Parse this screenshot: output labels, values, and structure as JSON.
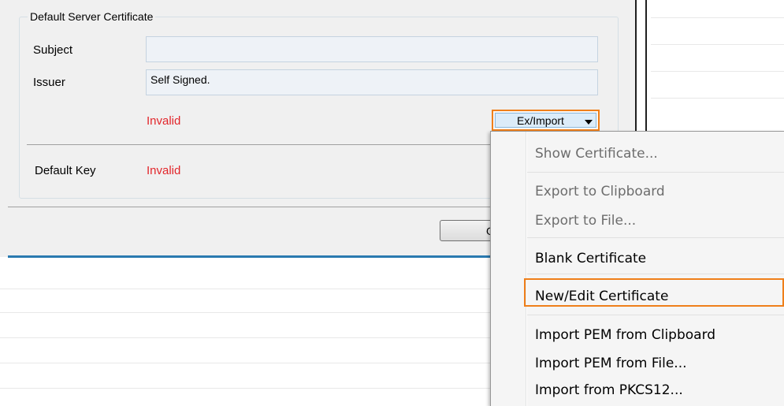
{
  "group": {
    "title": "Default Server Certificate"
  },
  "subject": {
    "label": "Subject",
    "value": ""
  },
  "issuer": {
    "label": "Issuer",
    "value": "Self Signed."
  },
  "cert_status": "Invalid",
  "default_key": {
    "label": "Default Key",
    "status": "Invalid"
  },
  "ex_import_button": {
    "label": "Ex/Import"
  },
  "ok_button": {
    "label": "OK"
  },
  "menu": {
    "show_certificate": "Show Certificate...",
    "export_clipboard": "Export to Clipboard",
    "export_file": "Export to File...",
    "blank_certificate": "Blank Certificate",
    "new_edit_certificate": "New/Edit Certificate",
    "import_pem_clipboard": "Import PEM from Clipboard",
    "import_pem_file": "Import PEM from File...",
    "import_pkcs12": "Import from PKCS12..."
  },
  "colors": {
    "invalid": "#e2262b",
    "highlight": "#ef7f1a",
    "accent": "#2a7ab0"
  }
}
